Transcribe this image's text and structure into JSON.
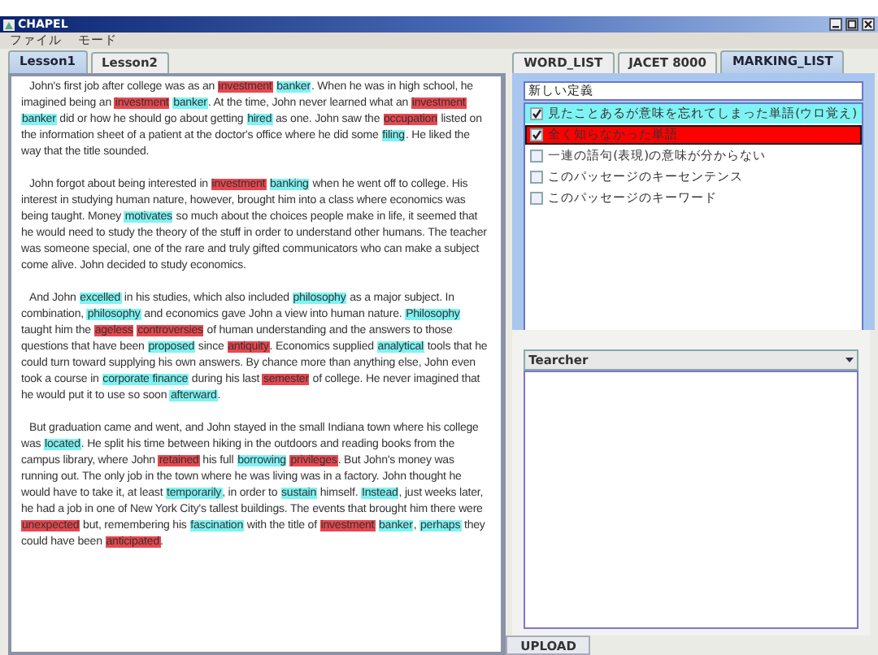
{
  "window": {
    "title": "CHAPEL"
  },
  "menu": [
    "ファイル",
    "モード"
  ],
  "lesson_tabs": [
    {
      "label": "Lesson1",
      "selected": true
    },
    {
      "label": "Lesson2",
      "selected": false
    }
  ],
  "passage": {
    "paragraphs": [
      {
        "segments": [
          {
            "text": "John's first job after college was as an "
          },
          {
            "text": "investment",
            "color": "#e8474f"
          },
          {
            "text": "banker",
            "color": "#7ff3f3"
          },
          {
            "text": ". When he was in high school, he imagined being an "
          },
          {
            "text": "investment",
            "color": "#e8474f"
          },
          {
            "text": "banker",
            "color": "#7ff3f3"
          },
          {
            "text": ". At the time, John never learned what an "
          },
          {
            "text": "investment",
            "color": "#e8474f"
          },
          {
            "text": "banker",
            "color": "#7ff3f3"
          },
          {
            "text": " did or how he should go about getting "
          },
          {
            "text": "hired",
            "color": "#7ff3f3"
          },
          {
            "text": " as one. John saw the "
          },
          {
            "text": "occupation",
            "color": "#e8474f"
          },
          {
            "text": " listed on the information sheet of a patient at the doctor's office where he did some "
          },
          {
            "text": "filing",
            "color": "#7ff3f3"
          },
          {
            "text": ". He liked the way that the title sounded."
          }
        ]
      },
      {
        "segments": [
          {
            "text": "John forgot about being interested in "
          },
          {
            "text": "investment",
            "color": "#e8474f"
          },
          {
            "text": "banking",
            "color": "#7ff3f3"
          },
          {
            "text": " when he went off to college. His interest in studying human nature, however, brought him into a class where economics was being taught. Money "
          },
          {
            "text": "motivates",
            "color": "#7ff3f3"
          },
          {
            "text": " so much about the choices people make in life, it seemed that he would need to study the theory of the stuff in order to understand other humans. The teacher was someone special, one of the rare and truly gifted communicators who can make a subject come alive. John decided to study economics."
          }
        ]
      },
      {
        "segments": [
          {
            "text": "And John "
          },
          {
            "text": "excelled",
            "color": "#7ff3f3"
          },
          {
            "text": " in his studies, which also included "
          },
          {
            "text": "philosophy",
            "color": "#7ff3f3"
          },
          {
            "text": " as a major subject. In combination, "
          },
          {
            "text": "philosophy",
            "color": "#7ff3f3"
          },
          {
            "text": " and economics gave John a view into human nature. "
          },
          {
            "text": "Philosophy",
            "color": "#7ff3f3"
          },
          {
            "text": " taught him the "
          },
          {
            "text": "ageless",
            "color": "#e8474f"
          },
          {
            "text": "controversies",
            "color": "#e8474f"
          },
          {
            "text": " of human understanding and the answers to those questions that have been "
          },
          {
            "text": "proposed",
            "color": "#7ff3f3"
          },
          {
            "text": " since "
          },
          {
            "text": "antiquity",
            "color": "#e8474f"
          },
          {
            "text": ". Economics supplied "
          },
          {
            "text": "analytical",
            "color": "#7ff3f3"
          },
          {
            "text": " tools that he could turn toward supplying his own answers. By chance more than anything else, John even took a course in "
          },
          {
            "text": "corporate finance",
            "color": "#7ff3f3"
          },
          {
            "text": " during his last "
          },
          {
            "text": "semester",
            "color": "#e8474f"
          },
          {
            "text": " of college. He never imagined that he would put it to use so soon "
          },
          {
            "text": "afterward",
            "color": "#7ff3f3"
          },
          {
            "text": "."
          }
        ]
      },
      {
        "segments": [
          {
            "text": "But graduation came and went, and John stayed in the small Indiana town where his college was "
          },
          {
            "text": "located",
            "color": "#7ff3f3"
          },
          {
            "text": ". He split his time between hiking in the outdoors and reading books from the campus library, where John "
          },
          {
            "text": "retained",
            "color": "#e8474f"
          },
          {
            "text": " his full "
          },
          {
            "text": "borrowing",
            "color": "#7ff3f3"
          },
          {
            "text": "privileges",
            "color": "#e8474f"
          },
          {
            "text": ". But John's money was running out. The only job in the town where he was living was in a factory. John thought he would have to take it, at least "
          },
          {
            "text": "temporarily",
            "color": "#7ff3f3"
          },
          {
            "text": ", in order to "
          },
          {
            "text": "sustain",
            "color": "#7ff3f3"
          },
          {
            "text": " himself. "
          },
          {
            "text": "Instead",
            "color": "#7ff3f3"
          },
          {
            "text": ", just weeks later, he had a job in one of New York City's tallest buildings. The events that brought him there were "
          },
          {
            "text": "unexpected",
            "color": "#e8474f"
          },
          {
            "text": " but, remembering his "
          },
          {
            "text": "fascination",
            "color": "#7ff3f3"
          },
          {
            "text": " with the title of "
          },
          {
            "text": "investment",
            "color": "#e8474f"
          },
          {
            "text": "banker",
            "color": "#7ff3f3"
          },
          {
            "text": ", "
          },
          {
            "text": "perhaps",
            "color": "#7ff3f3"
          },
          {
            "text": " they could have been "
          },
          {
            "text": "anticipated",
            "color": "#e8474f"
          },
          {
            "text": "."
          }
        ]
      }
    ]
  },
  "side_tabs": [
    {
      "label": "WORD_LIST",
      "selected": false
    },
    {
      "label": "JACET 8000",
      "selected": false
    },
    {
      "label": "MARKING_LIST",
      "selected": true
    }
  ],
  "marking": {
    "definition_field": {
      "value": "新しい定義"
    },
    "items": [
      {
        "label": "見たことあるが意味を忘れてしまった単語(ウロ覚え)",
        "checked": true,
        "selected": false,
        "color": "#7ff3f3"
      },
      {
        "label": "全く知らなかった単語",
        "checked": true,
        "selected": true,
        "color": "#ff0000"
      },
      {
        "label": "一連の語句(表現)の意味が分からない",
        "checked": false,
        "selected": false
      },
      {
        "label": "このパッセージのキーセンテンス",
        "checked": false,
        "selected": false
      },
      {
        "label": "このパッセージのキーワード",
        "checked": false,
        "selected": false
      }
    ]
  },
  "role_select": {
    "value": "Tearcher"
  },
  "upload_button": {
    "label": "UPLOAD"
  }
}
